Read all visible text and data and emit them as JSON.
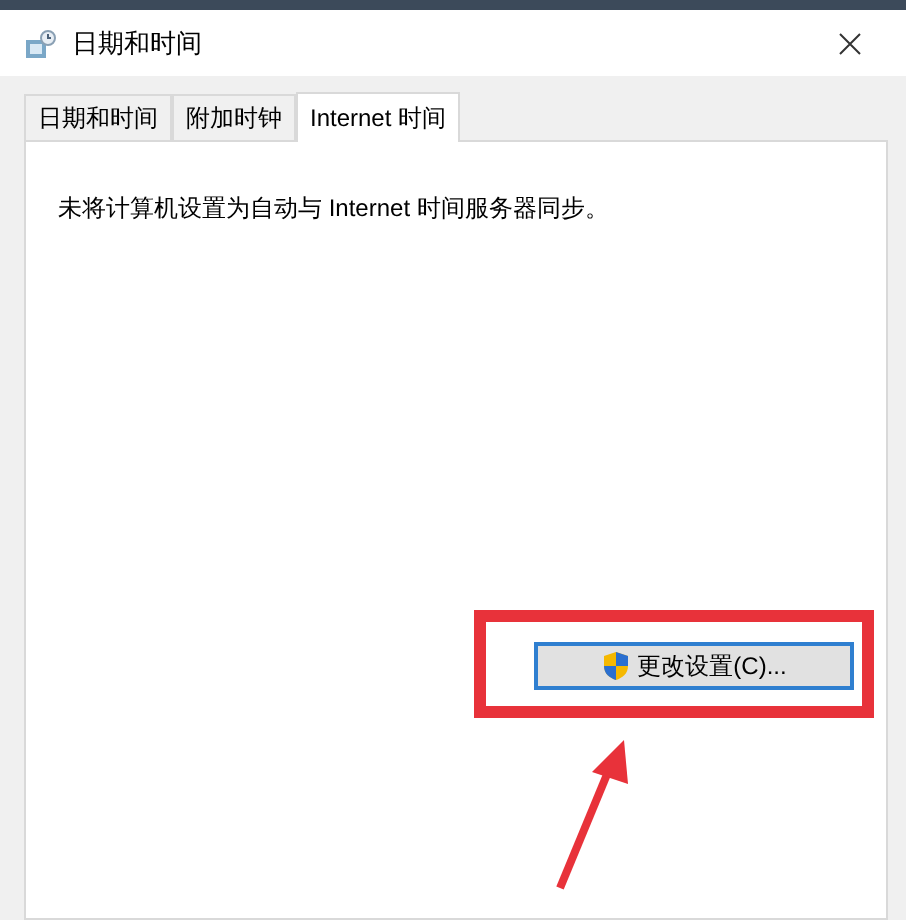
{
  "window": {
    "title": "日期和时间"
  },
  "tabs": [
    {
      "label": "日期和时间",
      "selected": false
    },
    {
      "label": "附加时钟",
      "selected": false
    },
    {
      "label": "Internet 时间",
      "selected": true
    }
  ],
  "message": "未将计算机设置为自动与 Internet 时间服务器同步。",
  "button": {
    "label": "更改设置(C)..."
  }
}
